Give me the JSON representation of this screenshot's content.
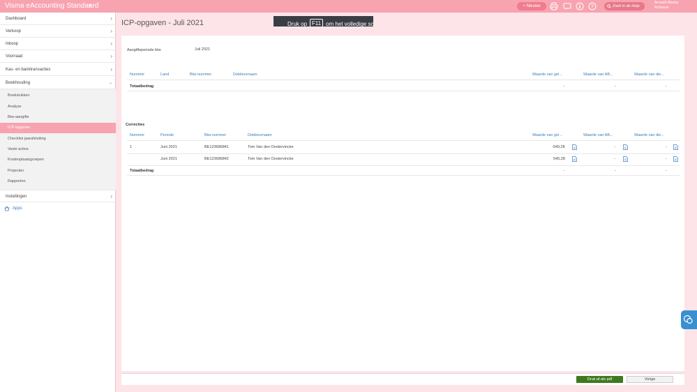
{
  "header": {
    "app_title": "Visma eAccounting Standaard",
    "new_label": "Nieuwe",
    "help_search": "Zoek in de Help",
    "user_name": "Arnould Westra",
    "user_role": "Achinese"
  },
  "overlay": {
    "text_before": "Druk op",
    "key": "F11",
    "text_after": "om het volledige sc"
  },
  "sidebar": {
    "items": [
      {
        "label": "Dashboard"
      },
      {
        "label": "Verkoop"
      },
      {
        "label": "Inkoop"
      },
      {
        "label": "Voorraad"
      },
      {
        "label": "Kas- en banktransacties"
      },
      {
        "label": "Boekhouding"
      }
    ],
    "sub_items": [
      {
        "label": "Boekstukken"
      },
      {
        "label": "Analyse"
      },
      {
        "label": "Btw-aangifte"
      },
      {
        "label": "ICP-opgaven"
      },
      {
        "label": "Checklist jaarafsluiting"
      },
      {
        "label": "Vaste activa"
      },
      {
        "label": "Kostenplaatsgroepen"
      },
      {
        "label": "Projecten"
      },
      {
        "label": "Rapporten"
      }
    ],
    "settings_label": "Instellingen",
    "apps_label": "Apps"
  },
  "page": {
    "title": "ICP-opgaven - Juli 2021",
    "period_label": "Aangifteperiode btw",
    "period_value": "Juli 2021"
  },
  "table1": {
    "columns": [
      "Nummer",
      "Land",
      "Btw-nummer",
      "Debiteurnaam",
      "Waarde van gel...",
      "Waarde van AB...",
      "Waarde van die..."
    ],
    "total_label": "Totaalbedrag",
    "totals": [
      "-",
      "-",
      "-"
    ]
  },
  "corrections": {
    "section_label": "Correcties",
    "columns": [
      "Nummer",
      "Periode",
      "Btw-nummer",
      "Debiteurnaam",
      "Waarde van gel...",
      "Waarde van AB...",
      "Waarde van die..."
    ],
    "rows": [
      {
        "nummer": "1",
        "periode": "Juni 2021",
        "btw": "BE123686841",
        "naam": "Tom Van den Oostervincke",
        "v1": "-540,28",
        "v2": "-",
        "v3": "-"
      },
      {
        "nummer": "",
        "periode": "Juni 2021",
        "btw": "BE123686842",
        "naam": "Tom Van den Oostervincke",
        "v1": "540,28",
        "v2": "-",
        "v3": "-"
      }
    ],
    "total_label": "Totaalbedrag",
    "totals": [
      "-",
      "-",
      "-"
    ]
  },
  "footer": {
    "pdf_label": "Druk af als pdf",
    "prev_label": "Vorige"
  },
  "colors": {
    "brand_pink": "#f8a3b0",
    "page_bg": "#fde4e8",
    "link_blue": "#3a7bbf",
    "pdf_green": "#3d7a1e"
  }
}
